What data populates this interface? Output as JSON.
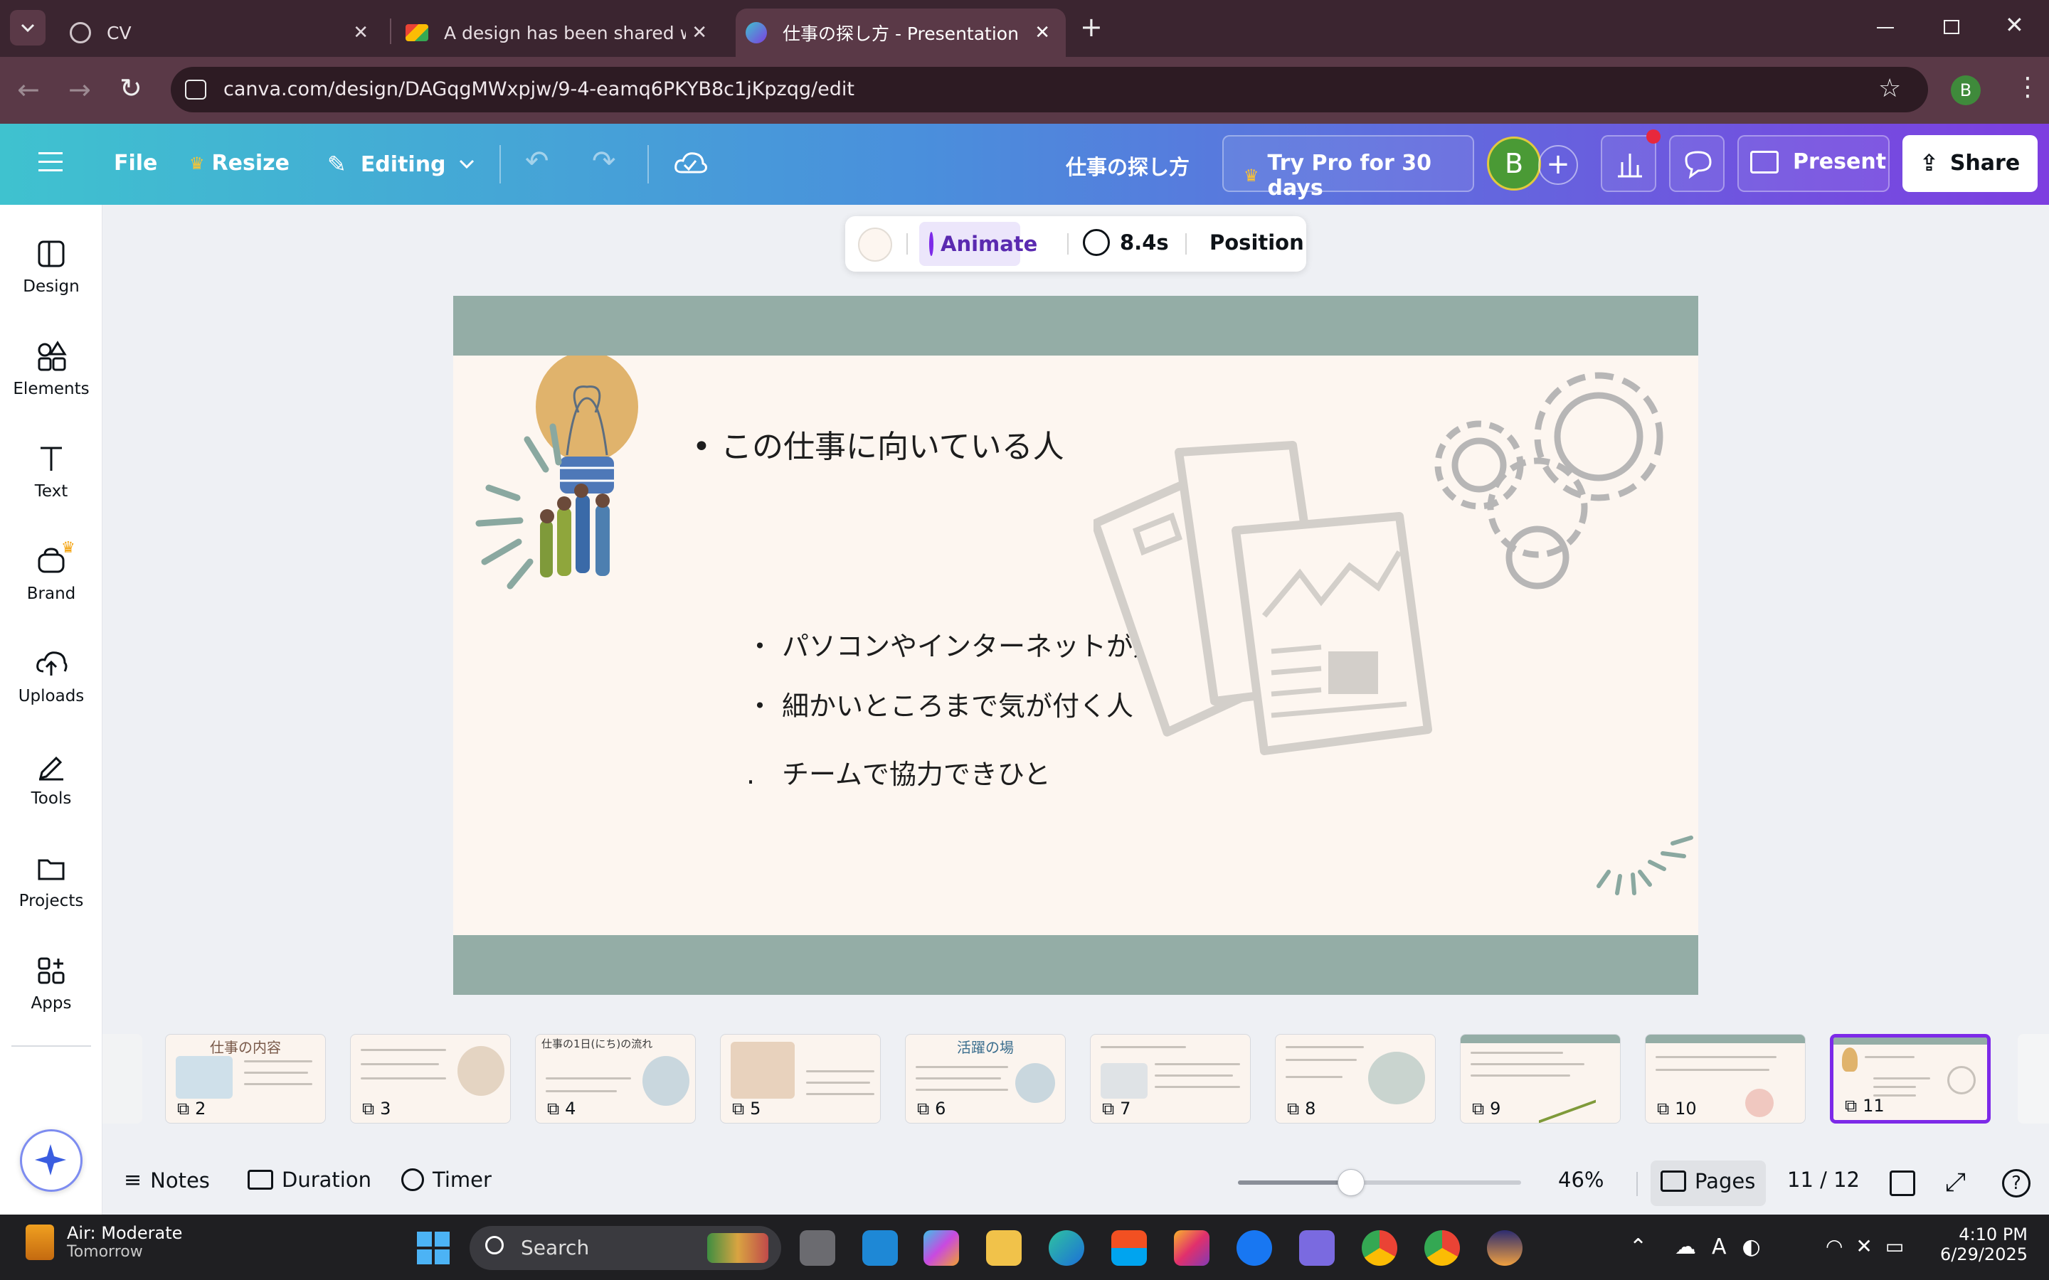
{
  "browser": {
    "tabs": [
      {
        "label": "CV",
        "favicon": "globe-icon"
      },
      {
        "label": "A design has been shared with",
        "favicon": "gmail-icon"
      },
      {
        "label": "仕事の探し方 - Presentation",
        "favicon": "canva-icon",
        "active": true
      }
    ],
    "url": "canva.com/design/DAGqgMWxpjw/9-4-eamq6PKYB8c1jKpzqg/edit",
    "profile_initial": "B"
  },
  "header": {
    "file": "File",
    "resize": "Resize",
    "editing": "Editing",
    "doc_title": "仕事の探し方",
    "try_pro": "Try Pro for 30 days",
    "avatar_initial": "B",
    "present": "Present",
    "share": "Share"
  },
  "sidebar": {
    "items": [
      {
        "label": "Design",
        "icon": "design-icon"
      },
      {
        "label": "Elements",
        "icon": "elements-icon"
      },
      {
        "label": "Text",
        "icon": "text-icon"
      },
      {
        "label": "Brand",
        "icon": "brand-icon"
      },
      {
        "label": "Uploads",
        "icon": "uploads-icon"
      },
      {
        "label": "Tools",
        "icon": "tools-icon"
      },
      {
        "label": "Projects",
        "icon": "projects-icon"
      },
      {
        "label": "Apps",
        "icon": "apps-icon"
      }
    ]
  },
  "toolbar": {
    "animate": "Animate",
    "duration": "8.4s",
    "position": "Position"
  },
  "slide": {
    "heading_bullet": "•",
    "heading": "この仕事に向いている人",
    "bullets": [
      {
        "marker": "・",
        "text": "パソコンやインターネットが好きな人"
      },
      {
        "marker": "・",
        "text": "細かいところまで気が付く人"
      },
      {
        "marker": ".",
        "text": "チームで協力できひと"
      }
    ],
    "colors": {
      "band": "#94ada6",
      "background": "#fdf6f0",
      "bulb": "#e0b36c"
    }
  },
  "filmstrip": {
    "thumbs": [
      {
        "num": "2",
        "title": "仕事の内容"
      },
      {
        "num": "3",
        "title": ""
      },
      {
        "num": "4",
        "title": "仕事の1日(にち)の流れ"
      },
      {
        "num": "5",
        "title": ""
      },
      {
        "num": "6",
        "title": "活躍の場"
      },
      {
        "num": "7",
        "title": ""
      },
      {
        "num": "8",
        "title": ""
      },
      {
        "num": "9",
        "title": ""
      },
      {
        "num": "10",
        "title": ""
      },
      {
        "num": "11",
        "title": "",
        "active": true
      }
    ]
  },
  "footer": {
    "notes": "Notes",
    "duration": "Duration",
    "timer": "Timer",
    "zoom": "46%",
    "zoom_fraction": 0.4,
    "pages": "Pages",
    "page_counter": "11 / 12"
  },
  "taskbar": {
    "weather_title": "Air: Moderate",
    "weather_sub": "Tomorrow",
    "search": "Search",
    "time": "4:10 PM",
    "date": "6/29/2025"
  }
}
